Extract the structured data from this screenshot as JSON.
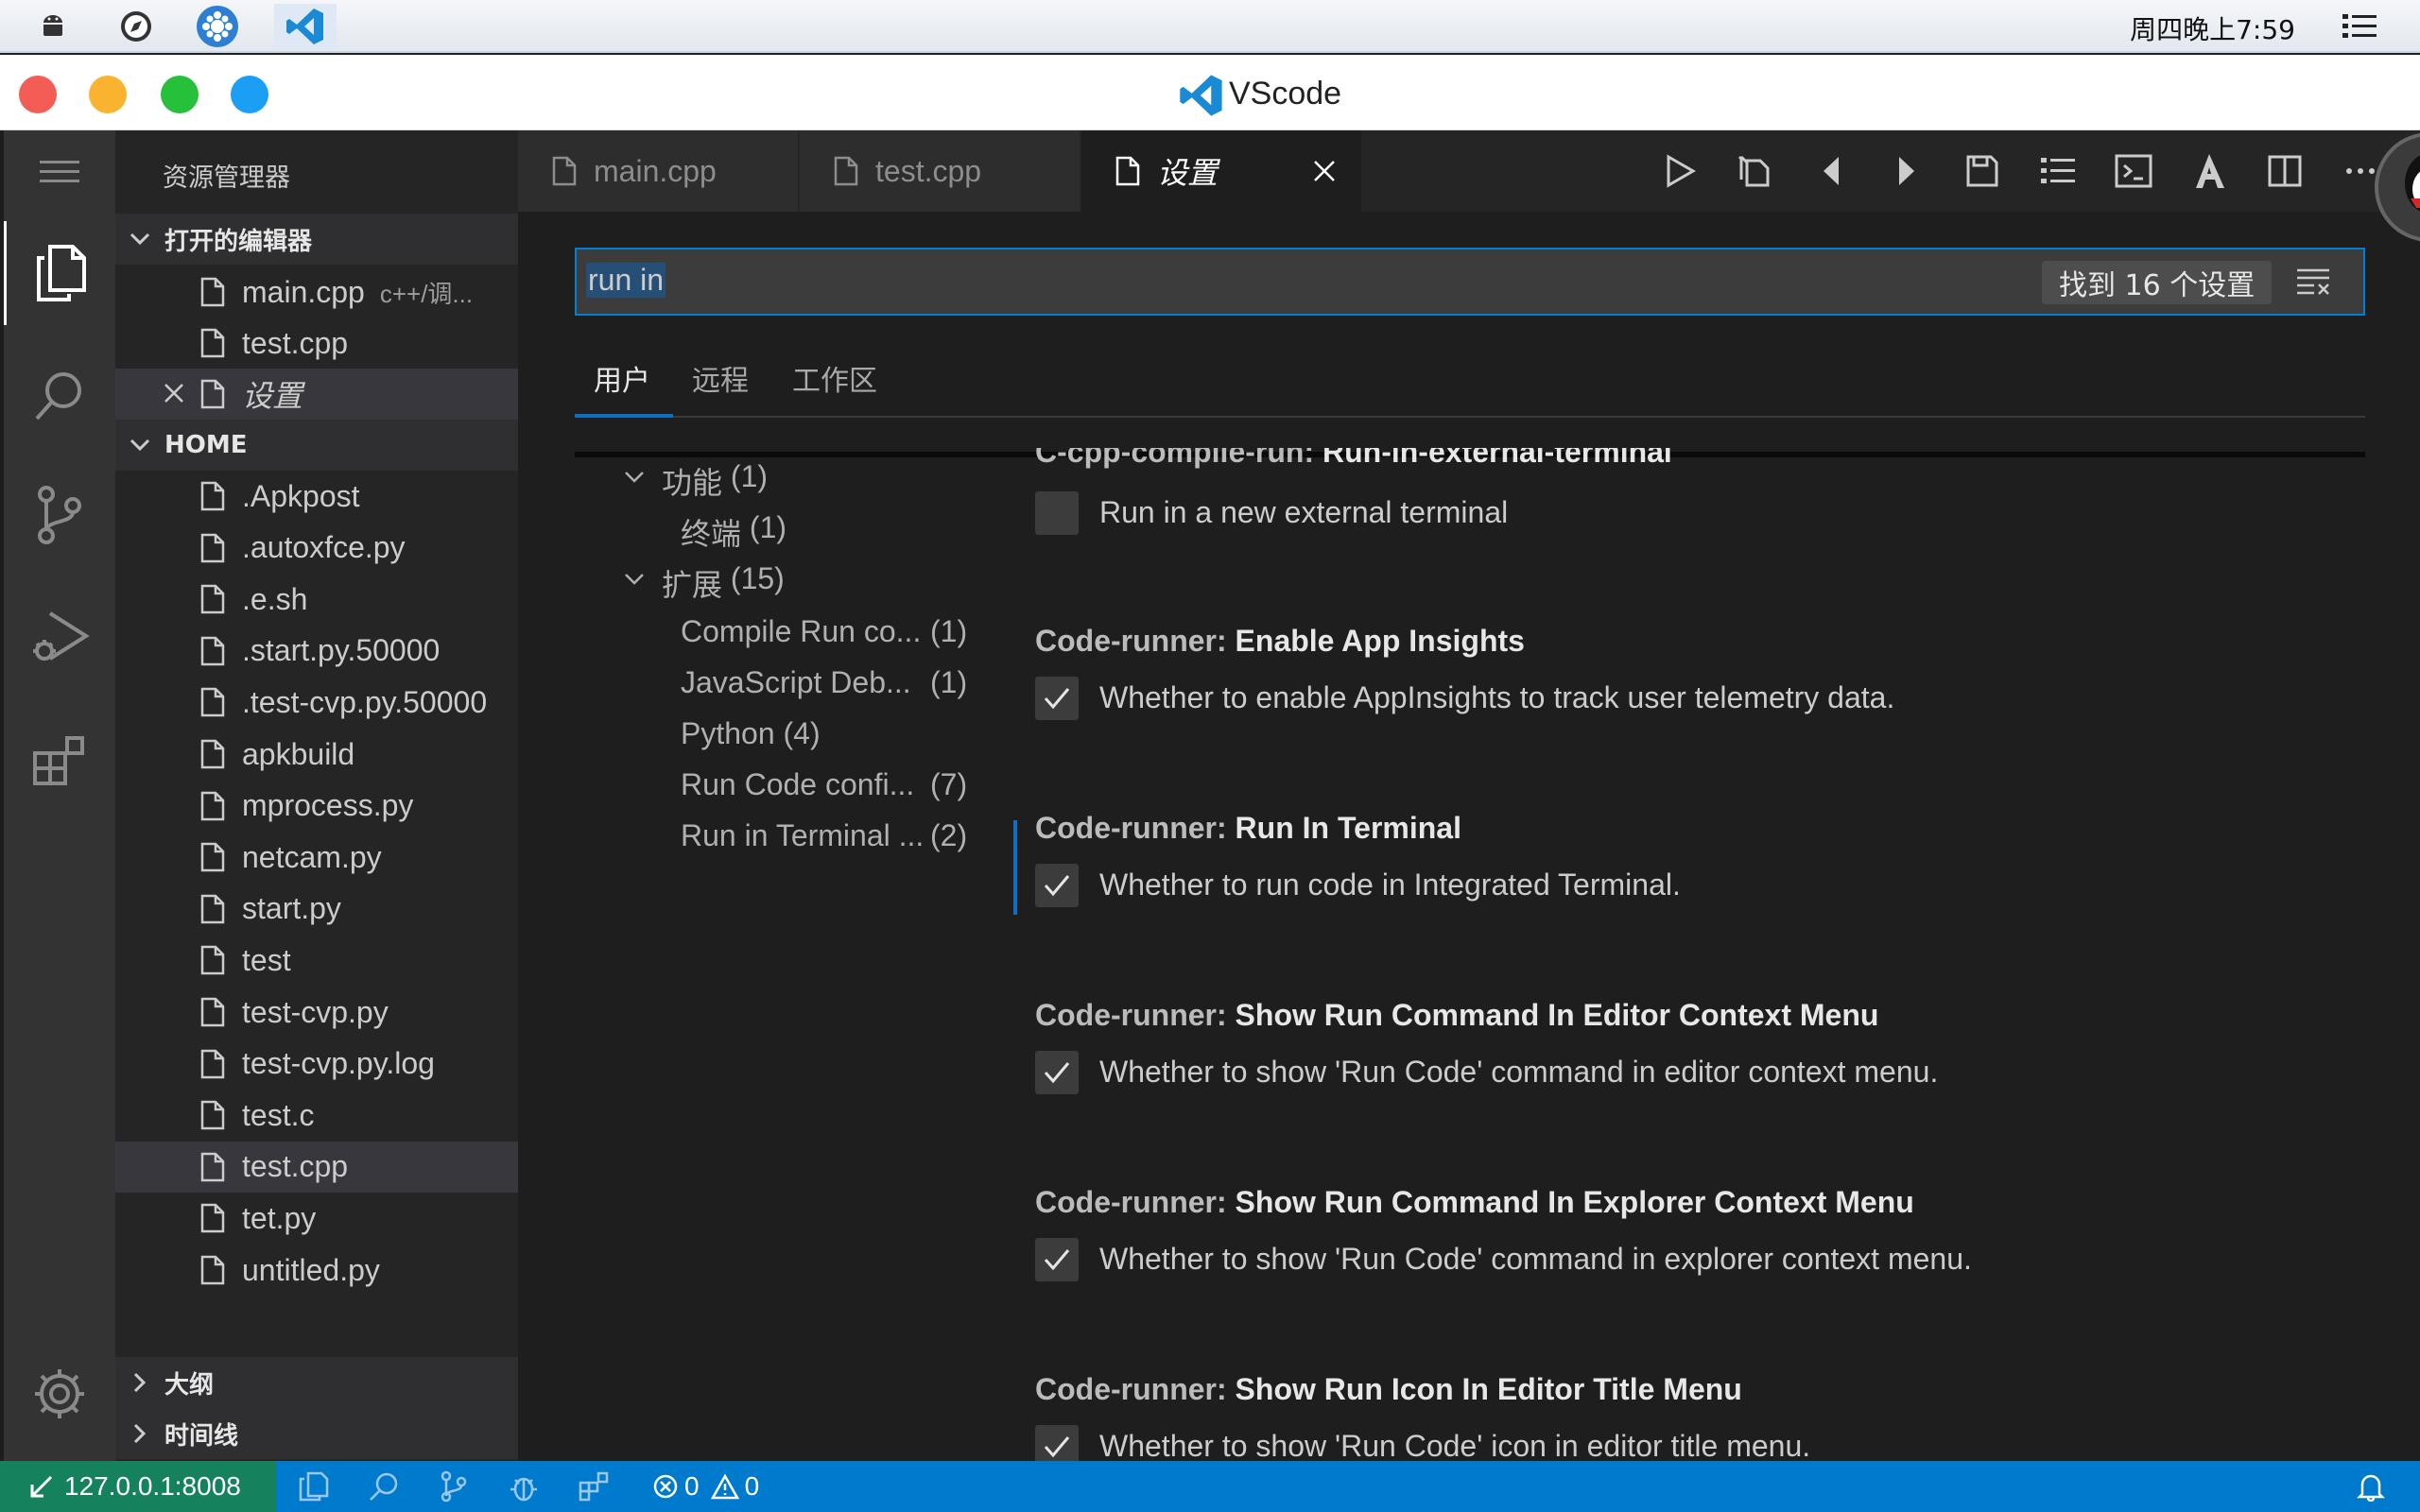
{
  "system_bar": {
    "clock": "周四晚上7:59",
    "tray_icons": [
      "android-icon",
      "compass-icon",
      "settings-flower-icon",
      "vscode-icon"
    ],
    "menu_icon": "list-menu-icon"
  },
  "window": {
    "title": "VScode",
    "traffic_lights": [
      "#f45d55",
      "#f9b32f",
      "#27c03a",
      "#1a9ff5"
    ]
  },
  "activity_bar": {
    "items": [
      "explorer-icon",
      "search-icon",
      "source-control-icon",
      "run-debug-icon",
      "extensions-icon"
    ],
    "bottom": "gear-icon"
  },
  "sidebar": {
    "header": "资源管理器",
    "open_editors": {
      "title": "打开的编辑器",
      "items": [
        {
          "name": "main.cpp",
          "desc": "c++/调..."
        },
        {
          "name": "test.cpp",
          "desc": ""
        },
        {
          "name": "设置",
          "desc": ""
        }
      ]
    },
    "home": {
      "title": "HOME",
      "files": [
        ".Apkpost",
        ".autoxfce.py",
        ".e.sh",
        ".start.py.50000",
        ".test-cvp.py.50000",
        "apkbuild",
        "mprocess.py",
        "netcam.py",
        "start.py",
        "test",
        "test-cvp.py",
        "test-cvp.py.log",
        "test.c",
        "test.cpp",
        "tet.py",
        "untitled.py"
      ],
      "selected": "test.cpp"
    },
    "outline": "大纲",
    "timeline": "时间线"
  },
  "tabs": [
    {
      "label": "main.cpp",
      "active": false
    },
    {
      "label": "test.cpp",
      "active": false
    },
    {
      "label": "设置",
      "active": true
    }
  ],
  "toolbar_icons": [
    "run-icon",
    "open-changes-icon",
    "prev-icon",
    "next-icon",
    "save-icon",
    "list-icon",
    "terminal-icon",
    "font-icon",
    "split-editor-icon",
    "more-icon"
  ],
  "settings": {
    "search_value": "run in",
    "found_label": "找到 16 个设置",
    "scope_tabs": [
      "用户",
      "远程",
      "工作区"
    ],
    "toc": [
      {
        "label": "功能",
        "count": "(1)",
        "level": 0
      },
      {
        "label": "终端",
        "count": "(1)",
        "level": 1
      },
      {
        "label": "扩展",
        "count": "(15)",
        "level": 0
      },
      {
        "label": "Compile Run co...",
        "count": "(1)",
        "level": 1
      },
      {
        "label": "JavaScript Deb...",
        "count": "(1)",
        "level": 1
      },
      {
        "label": "Python",
        "count": "(4)",
        "level": 1
      },
      {
        "label": "Run Code confi...",
        "count": "(7)",
        "level": 1
      },
      {
        "label": "Run in Terminal ...",
        "count": "(2)",
        "level": 1
      }
    ],
    "items": [
      {
        "category": "C-cpp-compile-run: ",
        "name": "Run-in-external-terminal",
        "desc": "Run in a new external terminal",
        "checked": false
      },
      {
        "category": "Code-runner: ",
        "name": "Enable App Insights",
        "desc": "Whether to enable AppInsights to track user telemetry data.",
        "checked": true
      },
      {
        "category": "Code-runner: ",
        "name": "Run In Terminal",
        "desc": "Whether to run code in Integrated Terminal.",
        "checked": true
      },
      {
        "category": "Code-runner: ",
        "name": "Show Run Command In Editor Context Menu",
        "desc": "Whether to show 'Run Code' command in editor context menu.",
        "checked": true
      },
      {
        "category": "Code-runner: ",
        "name": "Show Run Command In Explorer Context Menu",
        "desc": "Whether to show 'Run Code' command in explorer context menu.",
        "checked": true
      },
      {
        "category": "Code-runner: ",
        "name": "Show Run Icon In Editor Title Menu",
        "desc": "Whether to show 'Run Code' icon in editor title menu.",
        "checked": true
      }
    ]
  },
  "status_bar": {
    "remote": "127.0.0.1:8008",
    "errors": "0",
    "warnings": "0",
    "colors": {
      "bar": "#007acc",
      "remote": "#16825d"
    }
  }
}
